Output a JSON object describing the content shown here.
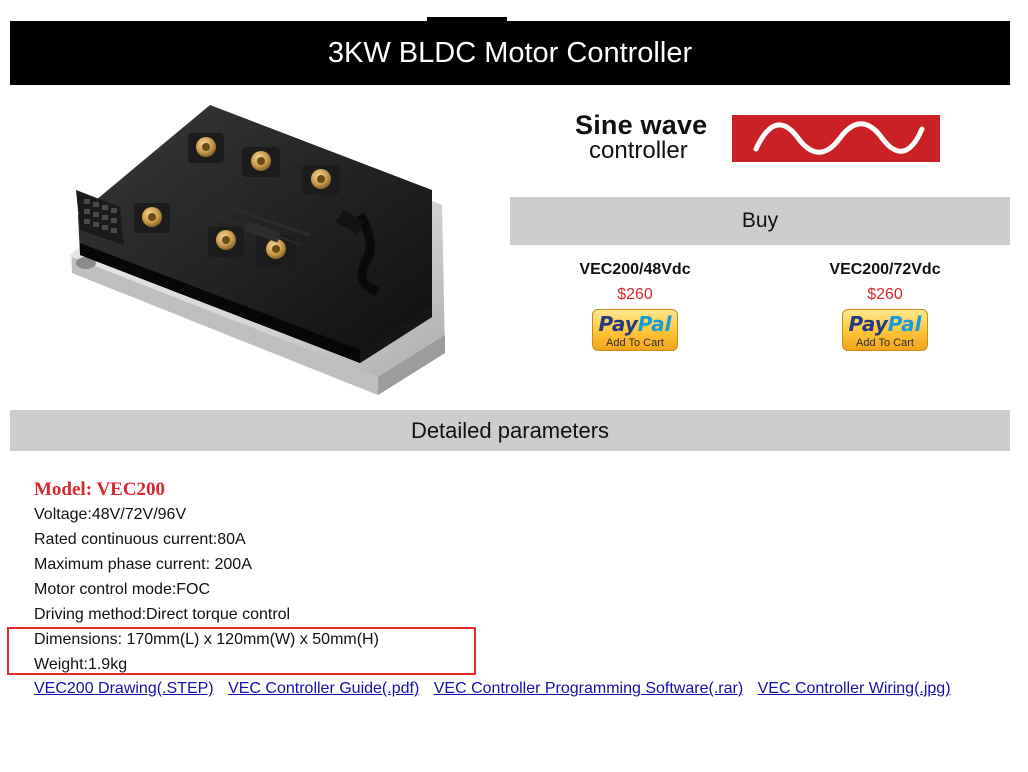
{
  "page": {
    "title": "3KW BLDC Motor Controller"
  },
  "logo": {
    "line1": "Sine wave",
    "line2": "controller"
  },
  "buy": {
    "header": "Buy",
    "options": [
      {
        "model": "VEC200/48Vdc",
        "price": "$260",
        "button_main_1": "Pay",
        "button_main_2": "Pal",
        "button_sub": "Add To Cart"
      },
      {
        "model": "VEC200/72Vdc",
        "price": "$260",
        "button_main_1": "Pay",
        "button_main_2": "Pal",
        "button_sub": "Add To Cart"
      }
    ]
  },
  "params": {
    "header": "Detailed parameters",
    "model_title": "Model: VEC200",
    "lines": [
      "Voltage:48V/72V/96V",
      "Rated continuous current:80A",
      "Maximum phase current: 200A",
      "Motor control mode:FOC",
      "Driving method:Direct torque control",
      "Dimensions: 170mm(L) x 120mm(W) x 50mm(H)",
      "Weight:1.9kg"
    ]
  },
  "links": [
    "VEC200 Drawing(.STEP)",
    "VEC Controller Guide(.pdf)",
    "VEC Controller Programming Software(.rar)",
    "VEC Controller Wiring(.jpg)"
  ],
  "colors": {
    "title_bar": "#000000",
    "section_bar": "#cccccc",
    "accent_red": "#d8262b",
    "link": "#1a0dab",
    "highlight_box": "#e12a2a"
  }
}
